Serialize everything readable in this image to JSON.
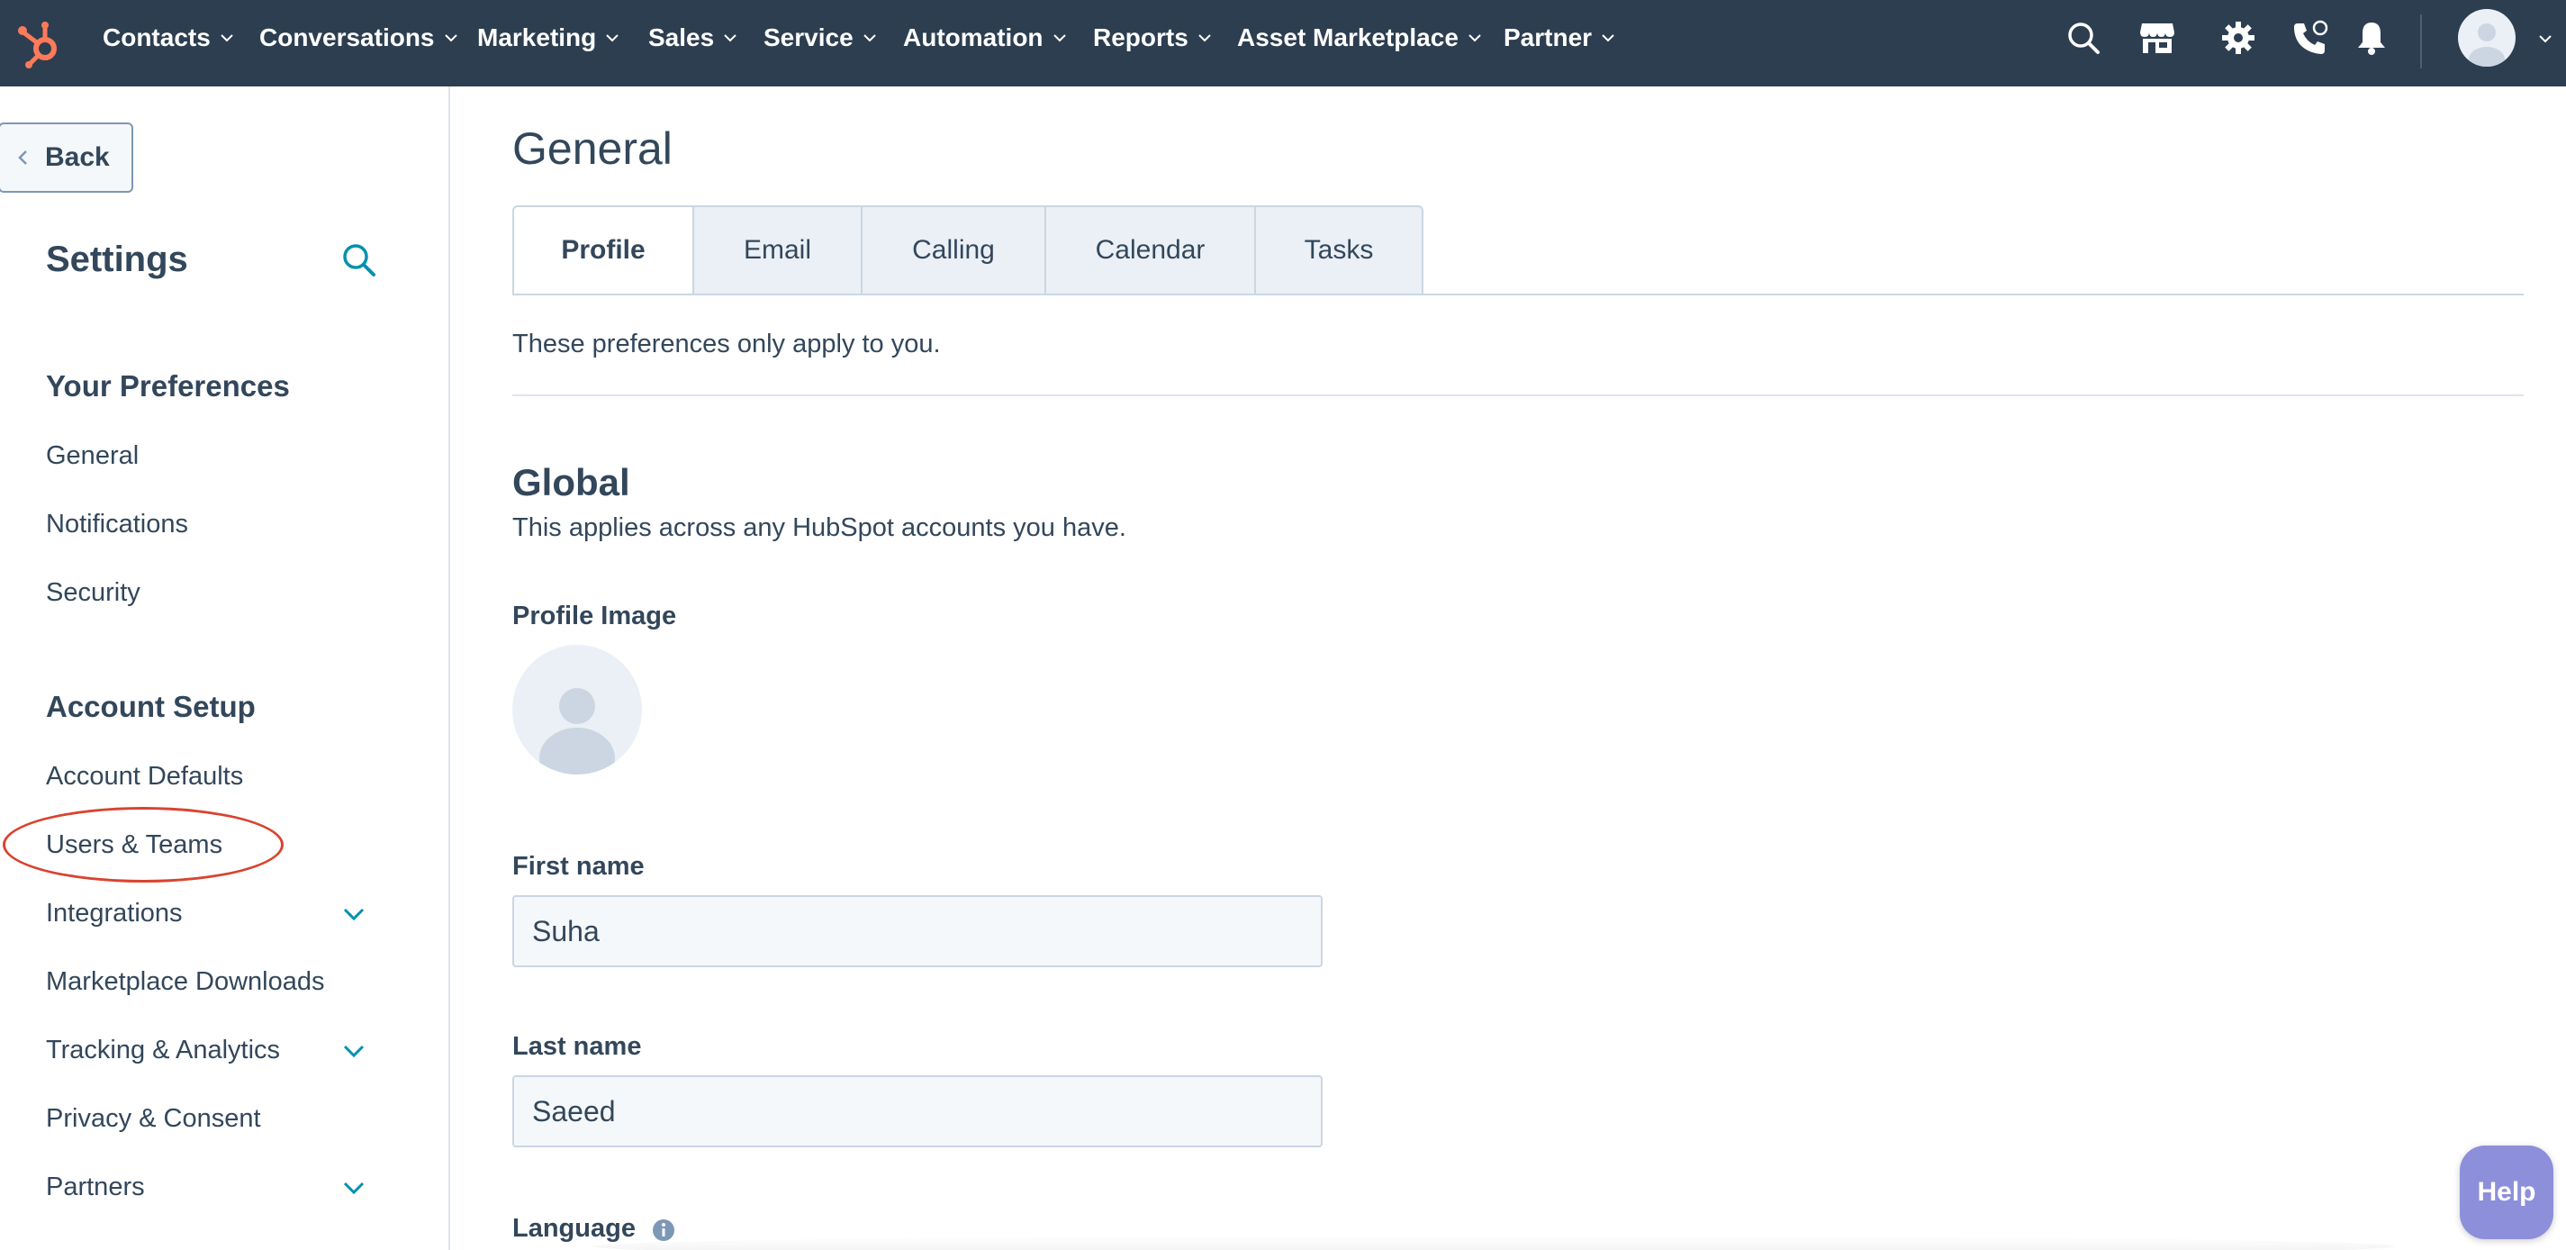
{
  "colors": {
    "nav_bg": "#2d3e50",
    "brand_orange": "#ff7a59",
    "text_primary": "#33475b",
    "link_blue": "#0091ae",
    "highlight_ring": "#d9432f",
    "help_button": "#8d8fdb"
  },
  "topnav": {
    "logo_icon": "hubspot-sprocket-icon",
    "items": [
      {
        "label": "Contacts"
      },
      {
        "label": "Conversations"
      },
      {
        "label": "Marketing"
      },
      {
        "label": "Sales"
      },
      {
        "label": "Service"
      },
      {
        "label": "Automation"
      },
      {
        "label": "Reports"
      },
      {
        "label": "Asset Marketplace"
      },
      {
        "label": "Partner"
      }
    ],
    "icons": [
      "search-icon",
      "marketplace-store-icon",
      "gear-icon",
      "calling-icon",
      "bell-icon",
      "avatar"
    ]
  },
  "sidebar": {
    "back_label": "Back",
    "title": "Settings",
    "sections": [
      {
        "heading": "Your Preferences",
        "items": [
          {
            "label": "General"
          },
          {
            "label": "Notifications"
          },
          {
            "label": "Security"
          }
        ]
      },
      {
        "heading": "Account Setup",
        "items": [
          {
            "label": "Account Defaults",
            "expandable": false
          },
          {
            "label": "Users & Teams",
            "expandable": false,
            "highlighted": true
          },
          {
            "label": "Integrations",
            "expandable": true
          },
          {
            "label": "Marketplace Downloads",
            "expandable": false
          },
          {
            "label": "Tracking & Analytics",
            "expandable": true
          },
          {
            "label": "Privacy & Consent",
            "expandable": false
          },
          {
            "label": "Partners",
            "expandable": true
          }
        ]
      }
    ]
  },
  "main": {
    "title": "General",
    "tabs": [
      {
        "label": "Profile",
        "active": true
      },
      {
        "label": "Email"
      },
      {
        "label": "Calling"
      },
      {
        "label": "Calendar"
      },
      {
        "label": "Tasks"
      }
    ],
    "note": "These preferences only apply to you.",
    "global": {
      "heading": "Global",
      "subtitle": "This applies across any HubSpot accounts you have.",
      "profile_image_label": "Profile Image",
      "first_name_label": "First name",
      "first_name_value": "Suha",
      "last_name_label": "Last name",
      "last_name_value": "Saeed",
      "language_label": "Language"
    }
  },
  "help": {
    "label": "Help"
  }
}
